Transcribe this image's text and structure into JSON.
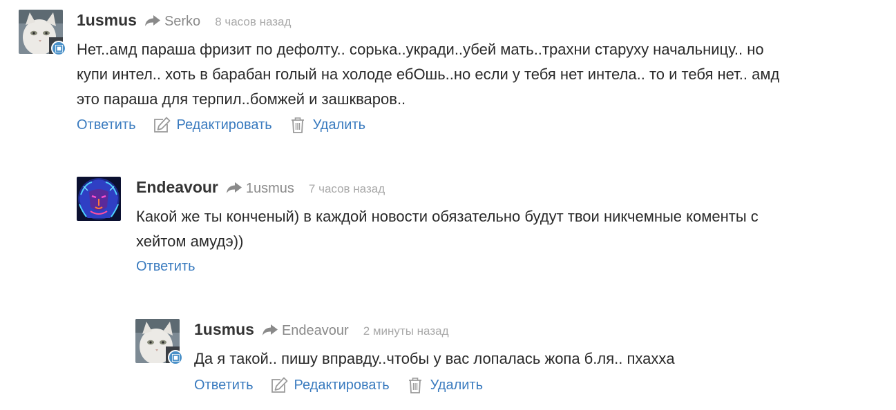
{
  "comments": [
    {
      "author": "1usmus",
      "reply_to": "Serko",
      "time": "8 часов назад",
      "lines": [
        "Нет..амд параша фризит по дефолту.. сорька..укради..убей мать..трахни старуху начальницу.. но",
        "купи интел.. хоть в барабан голый на холоде ебОшь..но если у тебя нет интела.. то и тебя нет.. амд",
        "это параша для терпил..бомжей и зашкваров.."
      ],
      "actions": {
        "reply": "Ответить",
        "edit": "Редактировать",
        "delete": "Удалить"
      },
      "avatar_icon": "cat-avatar-icon",
      "badge_icon": "windows-badge-icon"
    },
    {
      "author": "Endeavour",
      "reply_to": "1usmus",
      "time": "7 часов назад",
      "lines": [
        "Какой же ты конченый) в каждой новости обязательно будут твои никчемные коменты с",
        "хейтом амудэ))"
      ],
      "actions": {
        "reply": "Ответить"
      },
      "avatar_icon": "neon-lion-avatar-icon"
    },
    {
      "author": "1usmus",
      "reply_to": "Endeavour",
      "time": "2 минуты назад",
      "lines": [
        "Да я такой.. пишу вправду..чтобы у вас лопалась жопа б.ля.. пхаххa"
      ],
      "actions": {
        "reply": "Ответить",
        "edit": "Редактировать",
        "delete": "Удалить"
      },
      "avatar_icon": "cat-avatar-icon",
      "badge_icon": "windows-badge-icon"
    }
  ],
  "icons": {
    "reply_arrow": "share-arrow-icon",
    "edit": "pencil-square-icon",
    "delete": "trash-icon"
  },
  "colors": {
    "link": "#3a7bbf",
    "author": "#333333",
    "muted": "#8a8a8a",
    "timestamp": "#a8a8a8",
    "badge": "#4a90c8"
  }
}
